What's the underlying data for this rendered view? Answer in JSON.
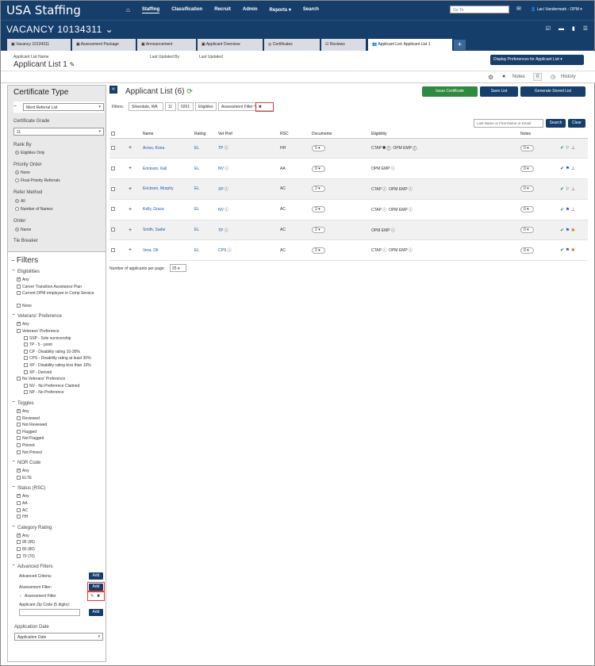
{
  "app": {
    "title": "USA Staffing",
    "nav": [
      "Staffing",
      "Classification",
      "Recruit",
      "Admin",
      "Reports",
      "Search"
    ],
    "goto_placeholder": "Go To",
    "user": "Laci Vandermark - OPM"
  },
  "vacancy": {
    "title": "VACANCY 10134311"
  },
  "tabs": [
    "Vacancy 10134311",
    "Assessment Package",
    "Announcement",
    "Applicant Overview",
    "Certificates",
    "Reviews",
    "Applicant List: Applicant List 1"
  ],
  "list_header": {
    "name_label": "Applicant List Name",
    "name": "Applicant List 1",
    "updated_by_label": "Last Updated By",
    "updated_label": "Last Updated",
    "display_prefs": "Display Preferences for Applicant List",
    "notes_label": "Notes",
    "notes_count": "0",
    "history_label": "History"
  },
  "sidebar": {
    "cert_type_title": "Certificate Type",
    "cert_type_value": "Merit Referral List",
    "cert_grade_label": "Certificate Grade",
    "cert_grade_value": "11",
    "rank_by_label": "Rank By",
    "rank_by_option": "Eligibles Only",
    "priority_label": "Priority Order",
    "priority_options": [
      "None",
      "Float Priority Referrals"
    ],
    "refer_label": "Refer Method",
    "refer_options": [
      "All",
      "Number of Names"
    ],
    "order_label": "Order",
    "order_option": "Name",
    "tie_label": "Tie Breaker",
    "filters_title": "Filters",
    "eligibilities_label": "Eligibilities",
    "eligibilities": [
      "Any",
      "Career Transition Assistance Plan",
      "Current OPM employee in Comp Service",
      "None"
    ],
    "vet_label": "Veterans' Preference",
    "vet_items": [
      "Any",
      "Veterans' Preference",
      "SSP - Sole survivorship",
      "TP - 5 - point",
      "CP - Disability rating 10-30%",
      "CPS - Disability rating at least 30%",
      "XP - Disability rating less than 10%",
      "XP - Derived",
      "No Veterans' Preference",
      "NV - No Preference Claimed",
      "NP - No Preference"
    ],
    "toggles_label": "Toggles",
    "toggles": [
      "Any",
      "Reviewed",
      "Not Reviewed",
      "Flagged",
      "Not Flagged",
      "Pinned",
      "Not Pinned"
    ],
    "nor_label": "NOR Code",
    "nor": [
      "Any",
      "ELTE"
    ],
    "status_label": "Status (RSC)",
    "status": [
      "Any",
      "AA",
      "AC",
      "HH"
    ],
    "cat_label": "Category Rating",
    "cat": [
      "Any",
      "95 (95)",
      "80 (80)",
      "70 (70)"
    ],
    "adv_label": "Advanced Filters",
    "adv_criteria": "Advanced Criteria:",
    "assess_filter": "Assessment Filter:",
    "assess_filter_item": "Assessment Filter",
    "zip_label": "Applicant Zip Code (5 digits):",
    "add": "Add",
    "app_date_label": "Application Date",
    "app_date_value": "Application Date"
  },
  "main": {
    "title": "Applicant List (6)",
    "issue_cert": "Issue Certificate",
    "save_list": "Save List",
    "gen_stored": "Generate Stored List",
    "filters_label": "Filters:",
    "chips": [
      "Silverdale, WA",
      "11",
      "0201",
      "Eligibles",
      "Assessment Filter"
    ],
    "search_placeholder": "Last Name or First Name or Email",
    "search_btn": "Search",
    "clear_btn": "Clear",
    "columns": [
      "Name",
      "Rating",
      "Vet Pref",
      "RSC",
      "Documents",
      "Eligibility",
      "Notes"
    ],
    "rows": [
      {
        "name": "Acres, Kona",
        "rating": "EL",
        "vet": "TP",
        "rsc": "HH",
        "docs": "5",
        "elig1": "CTAP",
        "elig2": "OPM EMP",
        "notes": "0"
      },
      {
        "name": "Erickson, Kali",
        "rating": "EL",
        "vet": "NV",
        "rsc": "AA",
        "docs": "0",
        "elig1": "",
        "elig2": "OPM EMP",
        "notes": "0"
      },
      {
        "name": "Erickson, Murphy",
        "rating": "EL",
        "vet": "XP",
        "rsc": "AC",
        "docs": "2",
        "elig1": "CTAP",
        "elig2": "OPM EMP",
        "notes": "0"
      },
      {
        "name": "Kelly, Grace",
        "rating": "EL",
        "vet": "NV",
        "rsc": "AC",
        "docs": "2",
        "elig1": "CTAP",
        "elig2": "OPM EMP",
        "notes": "0"
      },
      {
        "name": "Smith, Sadie",
        "rating": "EL",
        "vet": "TP",
        "rsc": "AC",
        "docs": "2",
        "elig1": "",
        "elig2": "OPM EMP",
        "notes": "0"
      },
      {
        "name": "Vera, Oli",
        "rating": "EL",
        "vet": "CPS",
        "rsc": "AC",
        "docs": "2",
        "elig1": "CTAP",
        "elig2": "OPM EMP",
        "notes": "0"
      }
    ],
    "per_page_label": "Number of applicants per page:",
    "per_page_value": "25"
  },
  "colors": {
    "brand": "#163e6b",
    "green": "#2e8a3e",
    "red": "#e23b3b"
  }
}
